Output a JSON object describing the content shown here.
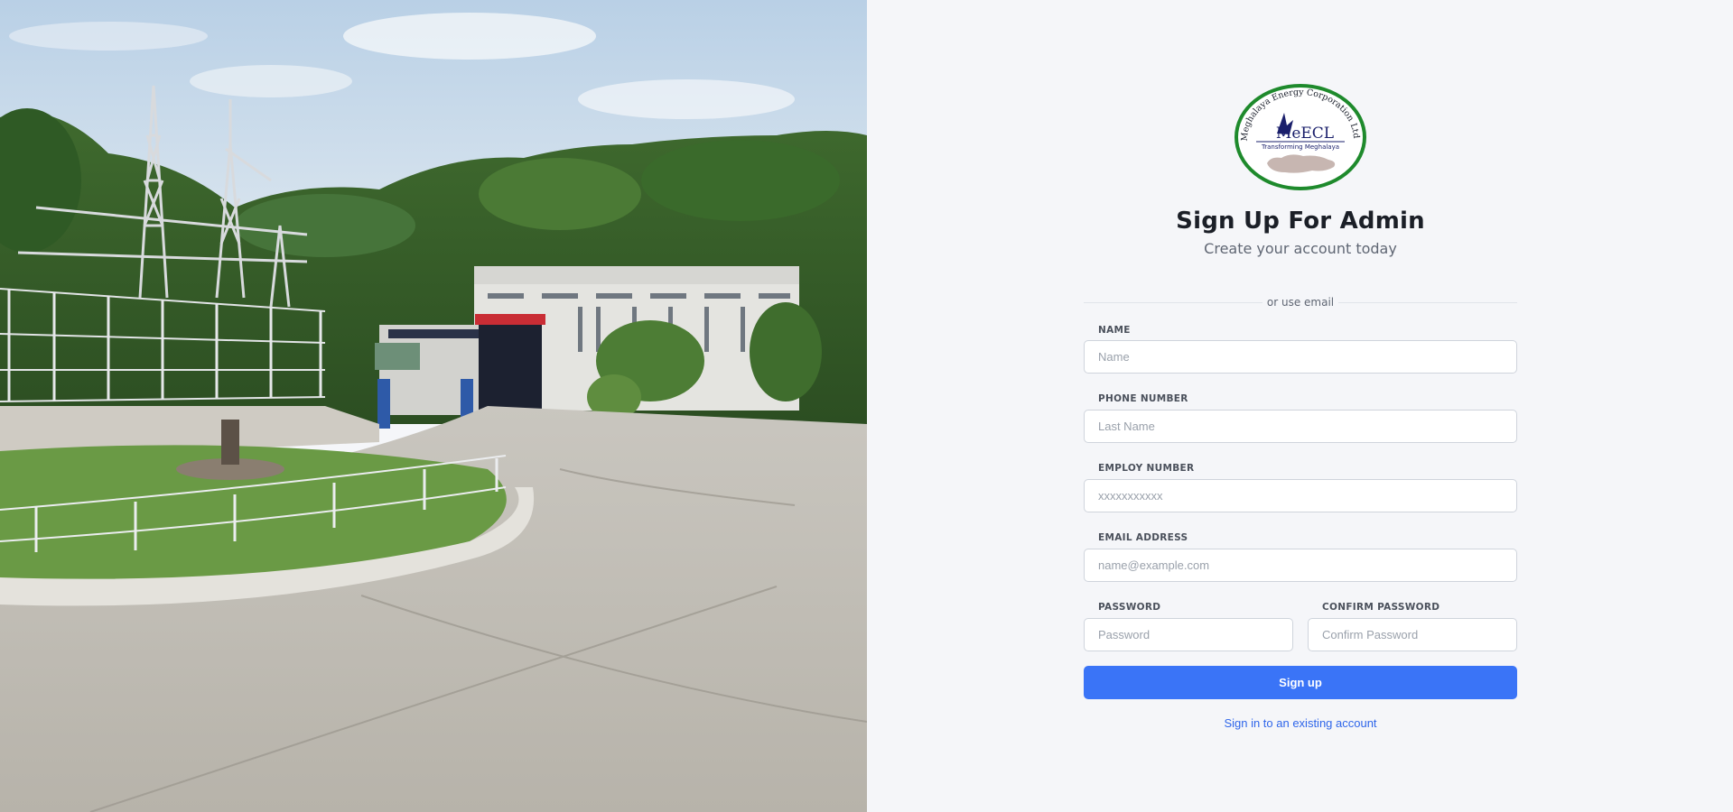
{
  "logo": {
    "ring_text": "Meghalaya Energy Corporation Ltd.",
    "wordmark": "MeECL",
    "tagline": "Transforming Meghalaya",
    "ring_color": "#1e8a2c",
    "wordmark_color": "#1a1f6b"
  },
  "heading": {
    "title": "Sign Up For Admin",
    "subtitle": "Create your account today"
  },
  "divider": {
    "text": "or use email"
  },
  "form": {
    "name": {
      "label": "NAME",
      "placeholder": "Name",
      "value": ""
    },
    "phone": {
      "label": "PHONE NUMBER",
      "placeholder": "Last Name",
      "value": ""
    },
    "employ": {
      "label": "EMPLOY NUMBER",
      "placeholder": "xxxxxxxxxxx",
      "value": ""
    },
    "email": {
      "label": "EMAIL ADDRESS",
      "placeholder": "name@example.com",
      "value": ""
    },
    "password": {
      "label": "PASSWORD",
      "placeholder": "Password",
      "value": ""
    },
    "confirm_password": {
      "label": "CONFIRM PASSWORD",
      "placeholder": "Confirm Password",
      "value": ""
    },
    "submit_label": "Sign up",
    "signin_link": "Sign in to an existing account"
  },
  "colors": {
    "primary": "#3a74f7",
    "link": "#2f66ea",
    "panel_bg": "#f5f6f9"
  }
}
